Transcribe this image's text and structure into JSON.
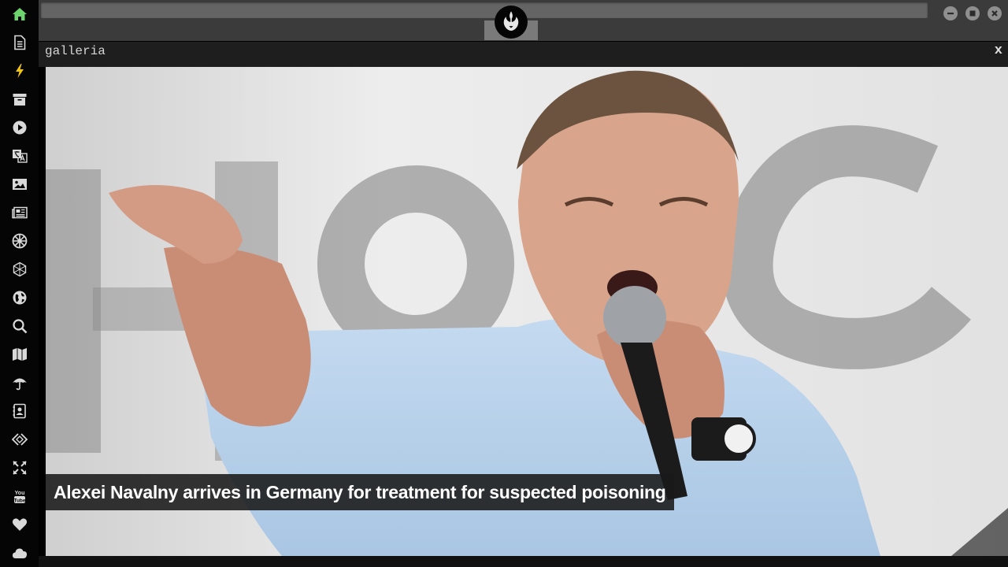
{
  "sidebar": {
    "items": [
      {
        "icon": "home-icon",
        "active": true
      },
      {
        "icon": "document-icon"
      },
      {
        "icon": "lightning-icon"
      },
      {
        "icon": "archive-icon"
      },
      {
        "icon": "play-icon"
      },
      {
        "icon": "translate-icon"
      },
      {
        "icon": "image-icon"
      },
      {
        "icon": "newspaper-icon"
      },
      {
        "icon": "empire-icon"
      },
      {
        "icon": "hexagon-net-icon"
      },
      {
        "icon": "globe-icon"
      },
      {
        "icon": "search-icon"
      },
      {
        "icon": "map-icon"
      },
      {
        "icon": "umbrella-icon"
      },
      {
        "icon": "contact-book-icon"
      },
      {
        "icon": "code-icon"
      },
      {
        "icon": "expand-icon"
      },
      {
        "icon": "youtube-icon"
      },
      {
        "icon": "heart-icon"
      },
      {
        "icon": "cloud-icon"
      }
    ],
    "accent_color": "#6dd36d",
    "icon_color": "#d9d9d9"
  },
  "topbar": {
    "logo_icon": "rebel-alliance-icon",
    "window_controls": [
      "minimize-icon",
      "maximize-icon",
      "close-icon"
    ]
  },
  "gallery": {
    "title": "galleria",
    "close_label": "x",
    "caption": "Alexei Navalny arrives in Germany for treatment for suspected poisoning"
  }
}
